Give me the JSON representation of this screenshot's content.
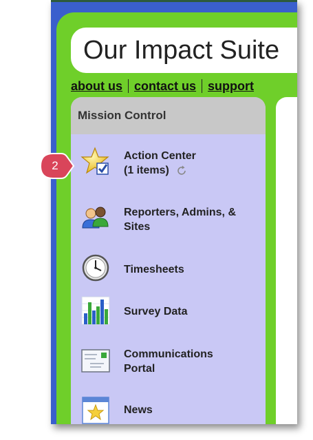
{
  "app": {
    "title": "Our Impact Suite"
  },
  "nav_links": [
    "about us",
    "contact us",
    "support"
  ],
  "panel": {
    "header": "Mission Control",
    "items": [
      {
        "line1": "Action Center",
        "line2": "(1 items)",
        "icon": "star-check-icon"
      },
      {
        "line1": "Reporters, Admins, &",
        "line2": "Sites",
        "icon": "users-icon"
      },
      {
        "line1": "Timesheets",
        "line2": "",
        "icon": "clock-icon"
      },
      {
        "line1": "Survey Data",
        "line2": "",
        "icon": "bar-chart-icon"
      },
      {
        "line1": "Communications",
        "line2": "Portal",
        "icon": "envelope-icon"
      },
      {
        "line1": "News",
        "line2": "",
        "icon": "news-star-icon"
      }
    ]
  },
  "callout": {
    "number": "2",
    "color": "#d9455a"
  },
  "colors": {
    "frame_blue": "#3a5fcd",
    "green": "#6fcf2a",
    "panel_lavender": "#c9c8f5",
    "header_gray": "#c8c8c8"
  }
}
